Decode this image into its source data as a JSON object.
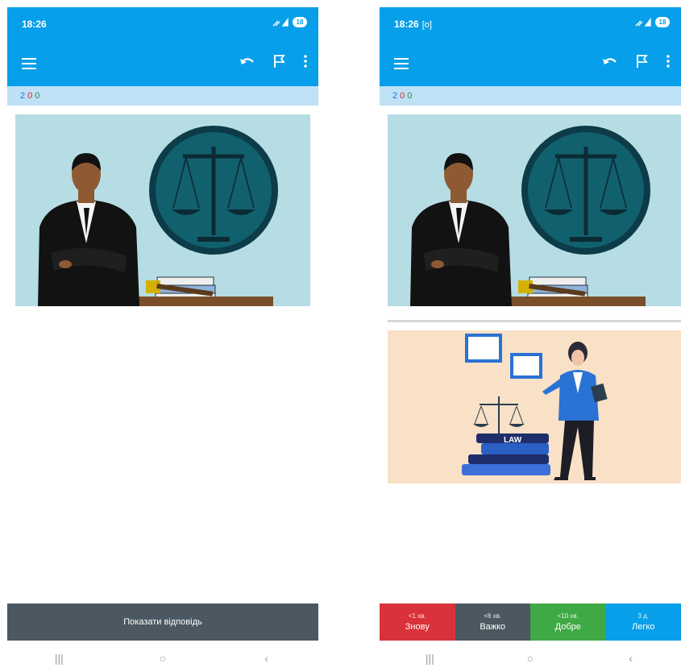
{
  "left": {
    "status": {
      "time": "18:26",
      "battery": "18"
    },
    "counts": {
      "new": "2",
      "learn": "0",
      "review": "0"
    },
    "show_answer_label": "Показати відповідь"
  },
  "right": {
    "status": {
      "time": "18:26",
      "rec_icon": "[o]",
      "battery": "18"
    },
    "counts": {
      "new": "2",
      "learn": "0",
      "review": "0"
    },
    "answer_image_text": "LAW",
    "ease_buttons": [
      {
        "time": "<1 хв.",
        "label": "Знову",
        "color": "#d9323a"
      },
      {
        "time": "<6 хв.",
        "label": "Важко",
        "color": "#4b5861"
      },
      {
        "time": "<10 хв.",
        "label": "Добре",
        "color": "#3fa945"
      },
      {
        "time": "3 д.",
        "label": "Легко",
        "color": "#079fe9"
      }
    ]
  },
  "icons": [
    "menu-icon",
    "undo-icon",
    "flag-icon",
    "more-vert-icon",
    "signal-icon",
    "battery-icon",
    "recent-apps-icon",
    "home-icon",
    "back-icon"
  ],
  "colors": {
    "appbar": "#079fe9",
    "countbar": "#bfe1f6",
    "show_answer": "#4b5861"
  }
}
